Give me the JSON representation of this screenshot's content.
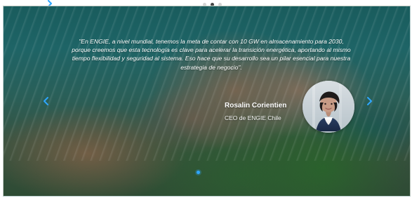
{
  "hero": {
    "quote_lines": [
      "\"En ENGIE, a nivel mundial, tenemos la meta de contar con 10 GW en almacenamiento para 2030,",
      "porque creemos que esta tecnología es clave para acelerar la transición energética, aportando al mismo",
      "tiempo flexibilidad y seguridad al sistema. Eso hace que su desarrollo sea un pilar esencial para nuestra",
      "estrategia de negocio\"."
    ],
    "author": {
      "name": "Rosalin Corientien",
      "role": "CEO de ENGIE Chile"
    }
  },
  "icons": {
    "left_nav": "chevron-left-icon",
    "right_nav": "chevron-right-icon",
    "carousel_marker": "carousel-marker",
    "top_dots": "carousel-dots"
  },
  "colors": {
    "accent_blue": "#2ea6ff",
    "text_white": "#ffffff"
  }
}
